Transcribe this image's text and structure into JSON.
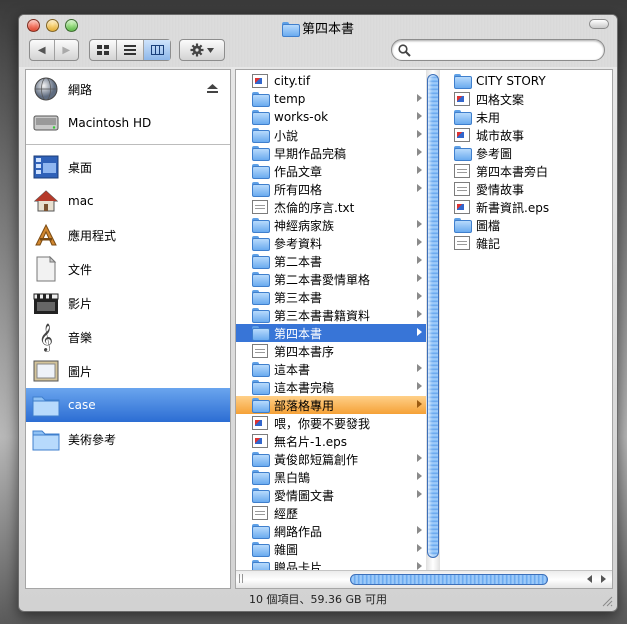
{
  "window": {
    "title": "第四本書"
  },
  "toolbar": {
    "back_label": "◀",
    "forward_label": "▶"
  },
  "search": {
    "placeholder": ""
  },
  "sidebar": {
    "items": [
      {
        "label": "網路",
        "icon": "network-globe-icon"
      },
      {
        "label": "Macintosh HD",
        "icon": "hard-drive-icon"
      },
      {
        "label": "桌面",
        "icon": "desktop-icon"
      },
      {
        "label": "mac",
        "icon": "home-icon"
      },
      {
        "label": "應用程式",
        "icon": "applications-icon"
      },
      {
        "label": "文件",
        "icon": "documents-icon"
      },
      {
        "label": "影片",
        "icon": "movies-icon"
      },
      {
        "label": "音樂",
        "icon": "music-icon"
      },
      {
        "label": "圖片",
        "icon": "pictures-icon"
      },
      {
        "label": "case",
        "icon": "folder-icon"
      },
      {
        "label": "美術參考",
        "icon": "folder-icon"
      }
    ],
    "selected": "case"
  },
  "column1": {
    "items": [
      {
        "label": "city.tif",
        "kind": "image",
        "arrow": false
      },
      {
        "label": "temp",
        "kind": "folder",
        "arrow": true
      },
      {
        "label": "works-ok",
        "kind": "folder",
        "arrow": true
      },
      {
        "label": "小說",
        "kind": "folder",
        "arrow": true
      },
      {
        "label": "早期作品完稿",
        "kind": "folder",
        "arrow": true
      },
      {
        "label": "作品文章",
        "kind": "folder",
        "arrow": true
      },
      {
        "label": "所有四格",
        "kind": "folder",
        "arrow": true
      },
      {
        "label": "杰倫的序言.txt",
        "kind": "doc",
        "arrow": false
      },
      {
        "label": "神經病家族",
        "kind": "folder",
        "arrow": true
      },
      {
        "label": "參考資料",
        "kind": "folder",
        "arrow": true
      },
      {
        "label": "第二本書",
        "kind": "folder",
        "arrow": true
      },
      {
        "label": "第二本書愛情單格",
        "kind": "folder",
        "arrow": true
      },
      {
        "label": "第三本書",
        "kind": "folder",
        "arrow": true
      },
      {
        "label": "第三本書書籍資料",
        "kind": "folder",
        "arrow": true
      },
      {
        "label": "第四本書",
        "kind": "folder",
        "arrow": true
      },
      {
        "label": "第四本書序",
        "kind": "doc",
        "arrow": false
      },
      {
        "label": "這本書",
        "kind": "folder",
        "arrow": true
      },
      {
        "label": "這本書完稿",
        "kind": "folder",
        "arrow": true
      },
      {
        "label": "部落格專用",
        "kind": "folder",
        "arrow": true
      },
      {
        "label": "喂，你要不要發我",
        "kind": "image",
        "arrow": false
      },
      {
        "label": "無名片-1.eps",
        "kind": "image",
        "arrow": false
      },
      {
        "label": "黃俊郎短篇創作",
        "kind": "folder",
        "arrow": true
      },
      {
        "label": "黑白鵠",
        "kind": "folder",
        "arrow": true
      },
      {
        "label": "愛情圖文書",
        "kind": "folder",
        "arrow": true
      },
      {
        "label": "經歷",
        "kind": "doc",
        "arrow": false
      },
      {
        "label": "網路作品",
        "kind": "folder",
        "arrow": true
      },
      {
        "label": "雜圖",
        "kind": "folder",
        "arrow": true
      },
      {
        "label": "贈品卡片",
        "kind": "folder",
        "arrow": true
      }
    ],
    "selected": "第四本書",
    "labeled": "部落格專用"
  },
  "column2": {
    "items": [
      {
        "label": "CITY STORY",
        "kind": "folder"
      },
      {
        "label": "四格文案",
        "kind": "image"
      },
      {
        "label": "未用",
        "kind": "folder"
      },
      {
        "label": "城市故事",
        "kind": "image"
      },
      {
        "label": "參考圖",
        "kind": "folder"
      },
      {
        "label": "第四本書旁白",
        "kind": "doc"
      },
      {
        "label": "愛情故事",
        "kind": "doc"
      },
      {
        "label": "新書資訊.eps",
        "kind": "image"
      },
      {
        "label": "圖檔",
        "kind": "folder"
      },
      {
        "label": "雜記",
        "kind": "doc"
      }
    ]
  },
  "status": {
    "text": "10 個項目、59.36 GB 可用"
  },
  "colors": {
    "selection": "#3875d7",
    "label_orange": "#f5a137",
    "sidebar_selection": "#2c6dd3"
  }
}
